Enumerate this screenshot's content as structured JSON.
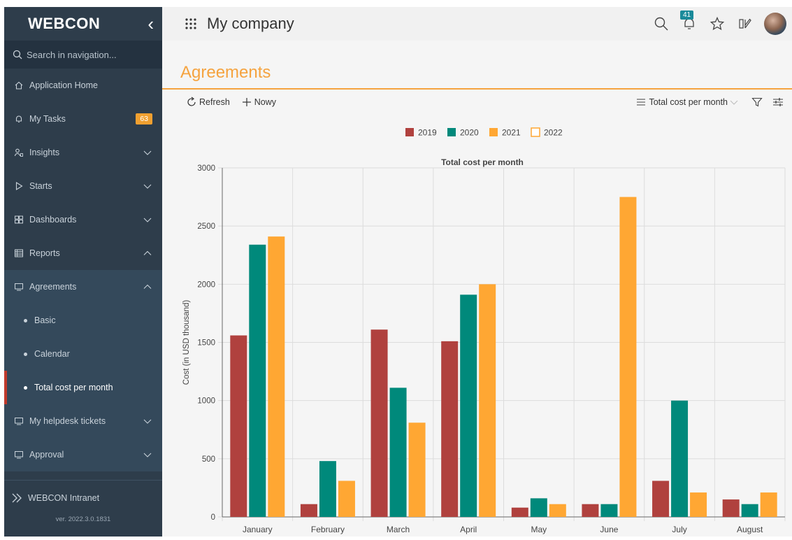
{
  "sidebar": {
    "brand": "WEBCON",
    "search_placeholder": "Search in navigation...",
    "items": [
      {
        "label": "Application Home"
      },
      {
        "label": "My Tasks",
        "badge": "63"
      },
      {
        "label": "Insights"
      },
      {
        "label": "Starts"
      },
      {
        "label": "Dashboards"
      },
      {
        "label": "Reports"
      },
      {
        "label": "Agreements"
      },
      {
        "label": "My helpdesk tickets"
      },
      {
        "label": "Approval"
      }
    ],
    "sub_items": [
      {
        "label": "Basic"
      },
      {
        "label": "Calendar"
      },
      {
        "label": "Total cost per month"
      }
    ],
    "intranet": "WEBCON Intranet",
    "version": "ver. 2022.3.0.1831"
  },
  "topbar": {
    "company": "My company",
    "notifications": "41"
  },
  "page": {
    "title": "Agreements",
    "refresh_label": "Refresh",
    "new_label": "Nowy",
    "view_label": "Total cost per month"
  },
  "colors": {
    "accent": "#f5a33f",
    "sidebar": "#2e3d4b",
    "series_2019": "#b0413e",
    "series_2020": "#00897b",
    "series_2021": "#ffa733",
    "series_2022": "#ffa733"
  },
  "chart_data": {
    "type": "bar",
    "title": "Total cost per month",
    "ylabel": "Cost (in USD thousand)",
    "xlabel": "",
    "ylim": [
      0,
      3000
    ],
    "yticks": [
      0,
      500,
      1000,
      1500,
      2000,
      2500,
      3000
    ],
    "categories": [
      "January",
      "February",
      "March",
      "April",
      "May",
      "June",
      "July",
      "August"
    ],
    "legend_position": "top",
    "grid": true,
    "series": [
      {
        "name": "2019",
        "color": "#b0413e",
        "values": [
          1560,
          110,
          1610,
          1510,
          80,
          110,
          310,
          150
        ]
      },
      {
        "name": "2020",
        "color": "#00897b",
        "values": [
          2340,
          480,
          1110,
          1910,
          160,
          110,
          1000,
          110
        ]
      },
      {
        "name": "2021",
        "color": "#ffa733",
        "values": [
          2410,
          310,
          810,
          2000,
          110,
          2750,
          210,
          210
        ]
      },
      {
        "name": "2022",
        "color": "#ffa733",
        "values": [
          0,
          0,
          0,
          0,
          0,
          0,
          0,
          0
        ],
        "hollow": true
      }
    ]
  }
}
